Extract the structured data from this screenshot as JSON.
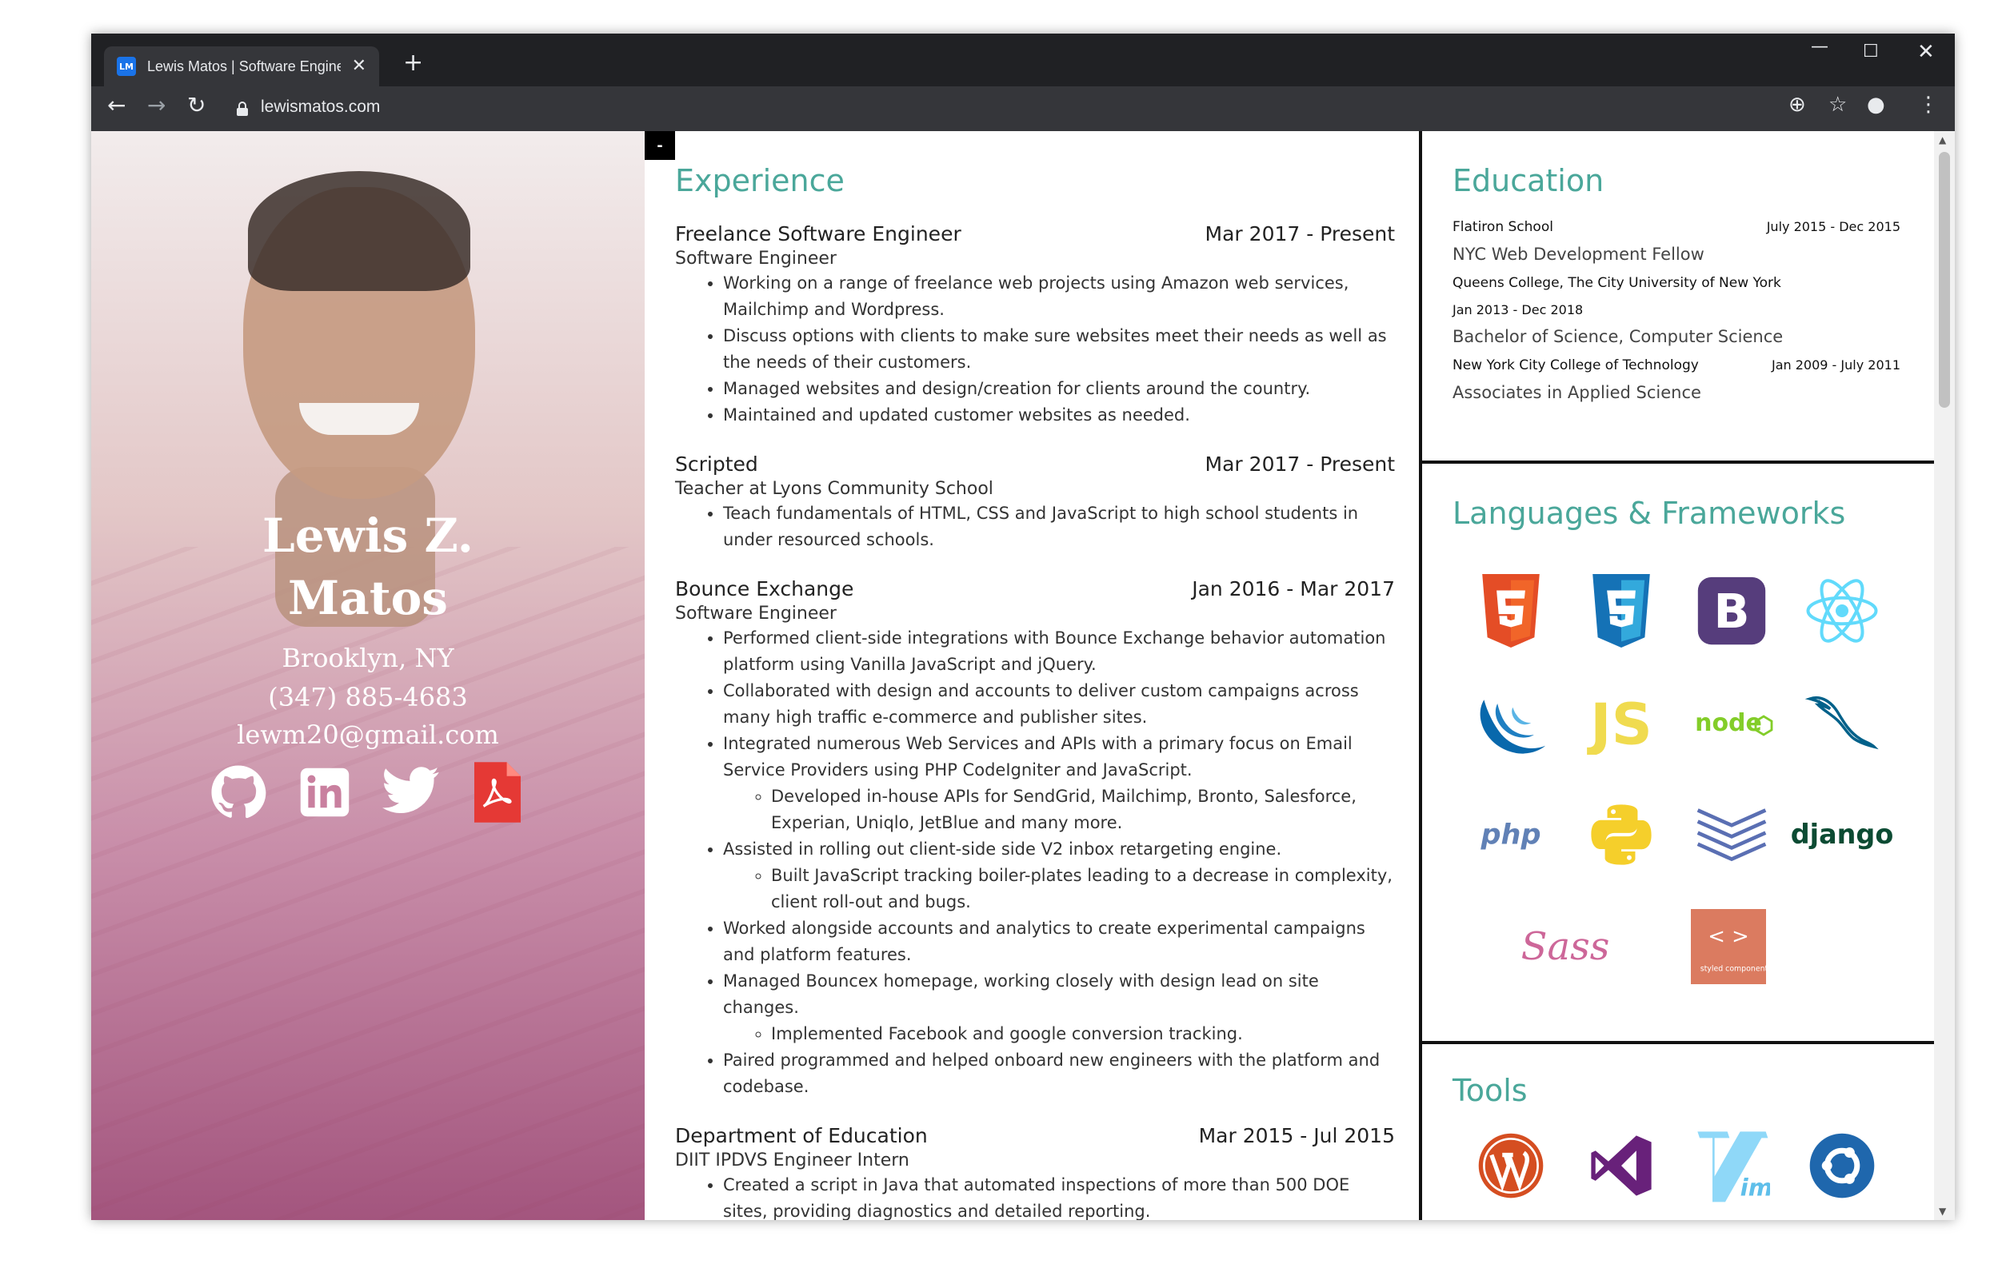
{
  "browser": {
    "tab_title": "Lewis Matos | Software Engineer",
    "favicon_text": "LM",
    "url": "lewismatos.com",
    "icons": [
      "back-icon",
      "forward-icon",
      "reload-icon",
      "lock-icon",
      "add-icon",
      "star-icon",
      "profile-icon",
      "menu-icon"
    ]
  },
  "toggle": {
    "label": "-"
  },
  "profile": {
    "name_line1": "Lewis Z.",
    "name_line2": "Matos",
    "location": "Brooklyn, NY",
    "phone": "(347) 885-4683",
    "email": "lewm20@gmail.com",
    "socials": [
      "github-icon",
      "linkedin-icon",
      "twitter-icon",
      "pdf-icon"
    ]
  },
  "experience": {
    "title": "Experience",
    "jobs": [
      {
        "company": "Freelance Software Engineer",
        "dates": "Mar 2017 - Present",
        "role": "Software Engineer",
        "bullets": [
          "Working on a range of freelance web projects using Amazon web services, Mailchimp and Wordpress.",
          "Discuss options with clients to make sure websites meet their needs as well as the needs of their customers.",
          "Managed websites and design/creation for clients around the country.",
          "Maintained and updated customer websites as needed."
        ]
      },
      {
        "company": "Scripted",
        "dates": "Mar 2017 - Present",
        "role": "Teacher at Lyons Community School",
        "bullets": [
          "Teach fundamentals of HTML, CSS and JavaScript to high school students in under resourced schools."
        ]
      },
      {
        "company": "Bounce Exchange",
        "dates": "Jan 2016 - Mar 2017",
        "role": "Software Engineer",
        "bullets": [
          "Performed client-side integrations with Bounce Exchange behavior automation platform using Vanilla JavaScript and jQuery.",
          "Collaborated with design and accounts to deliver custom campaigns across many high traffic e-commerce and publisher sites.",
          "Integrated numerous Web Services and APIs with a primary focus on Email Service Providers using PHP CodeIgniter and JavaScript.",
          "Assisted in rolling out client-side side V2 inbox retargeting engine.",
          "Worked alongside accounts and analytics to create experimental campaigns and platform features.",
          "Managed Bouncex homepage, working closely with design lead on site changes.",
          "Paired programmed and helped onboard new engineers with the platform and codebase."
        ],
        "sub_bullets": [
          "Developed in-house APIs for SendGrid, Mailchimp, Bronto, Salesforce, Experian, Uniqlo, JetBlue and many more.",
          "Built JavaScript tracking boiler-plates leading to a decrease in complexity, client roll-out and bugs.",
          "Implemented Facebook and google conversion tracking."
        ]
      },
      {
        "company": "Department of Education",
        "dates": "Mar 2015 - Jul 2015",
        "role": "DIIT IPDVS Engineer Intern",
        "bullets": [
          "Created a script in Java that automated inspections of more than 500 DOE sites, providing diagnostics and detailed reporting."
        ]
      }
    ]
  },
  "education": {
    "title": "Education",
    "items": [
      {
        "school": "Flatiron School",
        "dates": "July 2015 - Dec 2015",
        "degree": "NYC Web Development Fellow"
      },
      {
        "school": "Queens College, The City University of New York",
        "dates": "Jan 2013 - Dec 2018",
        "degree": "Bachelor of Science, Computer Science"
      },
      {
        "school": "New York City College of Technology",
        "dates": "Jan 2009 - July 2011",
        "degree": "Associates in Applied Science"
      }
    ]
  },
  "languages": {
    "title": "Languages & Frameworks",
    "logos": [
      "html5-icon",
      "css3-icon",
      "bootstrap-icon",
      "react-icon",
      "jquery-icon",
      "javascript-icon",
      "nodejs-icon",
      "mysql-icon",
      "php-icon",
      "python-icon",
      "laravel-stack-icon",
      "django-icon",
      "sass-icon",
      "styled-components-icon"
    ],
    "logo_text": {
      "bootstrap": "B",
      "js": "JS",
      "node": "node",
      "php": "php",
      "django": "django",
      "sass": "Sass",
      "styled": "styled components"
    }
  },
  "tools": {
    "title": "Tools",
    "logos": [
      "wordpress-icon",
      "visual-studio-icon",
      "vim-icon",
      "ubuntu-icon"
    ]
  },
  "colors": {
    "accent": "#4aa79a",
    "html5": "#e44d26",
    "css3": "#1572b6",
    "bootstrap": "#563d7c",
    "react": "#61dafb",
    "js": "#f0db4f",
    "node": "#83cd29",
    "django": "#0c4b33",
    "sass": "#cd6799"
  }
}
